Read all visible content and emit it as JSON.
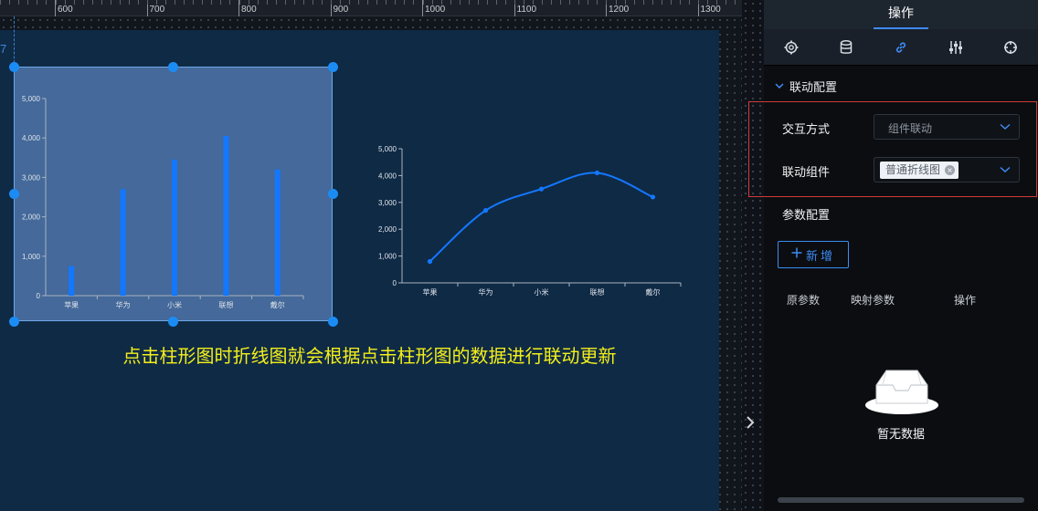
{
  "ruler": {
    "labels": [
      "600",
      "700",
      "800",
      "900",
      "1000",
      "1100",
      "1200",
      "1300"
    ]
  },
  "guide_number": "7",
  "caption": "点击柱形图时折线图就会根据点击柱形图的数据进行联动更新",
  "bar_chart": {
    "type": "bar",
    "categories": [
      "苹果",
      "华为",
      "小米",
      "联想",
      "戴尔"
    ],
    "values": [
      750,
      2700,
      3450,
      4050,
      3200
    ],
    "yticks": [
      "0",
      "1,000",
      "2,000",
      "3,000",
      "4,000",
      "5,000"
    ],
    "ylim": [
      0,
      5000
    ],
    "color": "#1378ff"
  },
  "chart_data": [
    {
      "type": "bar",
      "categories": [
        "苹果",
        "华为",
        "小米",
        "联想",
        "戴尔"
      ],
      "values": [
        750,
        2700,
        3450,
        4050,
        3200
      ],
      "ylim": [
        0,
        5000
      ]
    },
    {
      "type": "line",
      "categories": [
        "苹果",
        "华为",
        "小米",
        "联想",
        "戴尔"
      ],
      "values": [
        800,
        2700,
        3500,
        4100,
        3200
      ],
      "ylim": [
        0,
        5000
      ]
    }
  ],
  "line_chart": {
    "type": "line",
    "categories": [
      "苹果",
      "华为",
      "小米",
      "联想",
      "戴尔"
    ],
    "values": [
      800,
      2700,
      3500,
      4100,
      3200
    ],
    "yticks": [
      "0",
      "1,000",
      "2,000",
      "3,000",
      "4,000",
      "5,000"
    ],
    "ylim": [
      0,
      5000
    ],
    "color": "#1378ff"
  },
  "panel": {
    "title": "操作",
    "tabs": [
      "settings-icon",
      "database-icon",
      "link-icon",
      "sliders-icon",
      "target-icon"
    ],
    "active_tab": "link-icon",
    "section_title": "联动配置",
    "interaction_label": "交互方式",
    "interaction_value": "组件联动",
    "linked_label": "联动组件",
    "linked_tag": "普通折线图",
    "param_section": "参数配置",
    "add_label": "新增",
    "columns": [
      "原参数",
      "映射参数",
      "操作"
    ],
    "empty_text": "暂无数据"
  },
  "colors": {
    "accent": "#3d8bf5",
    "canvas": "#0f2a45",
    "caption": "#f3ef1b",
    "highlight": "#cf3b3b"
  }
}
